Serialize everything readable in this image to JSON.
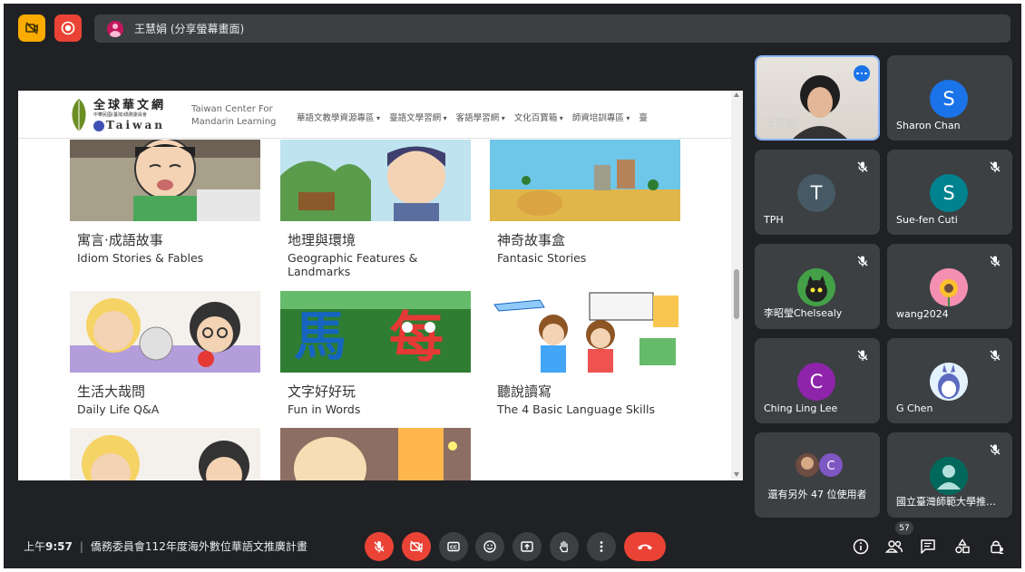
{
  "presenter": {
    "label": "王慧娟 (分享螢幕畫面)"
  },
  "site": {
    "logo_title": "全球華文網",
    "logo_sub": "中華民國(臺灣)僑務委員會",
    "logo_taiwan": "Taiwan",
    "center_name": "Taiwan Center For Mandarin Learning",
    "nav": [
      "華語文教學資源專區",
      "臺語文學習網",
      "客語學習網",
      "文化百寶箱",
      "師資培訓專區",
      "臺"
    ]
  },
  "cards": [
    {
      "zh": "寓言·成語故事",
      "en": "Idiom Stories & Fables"
    },
    {
      "zh": "地理與環境",
      "en": "Geographic Features & Landmarks"
    },
    {
      "zh": "神奇故事盒",
      "en": "Fantasic Stories"
    },
    {
      "zh": "生活大哉問",
      "en": "Daily Life Q&A"
    },
    {
      "zh": "文字好好玩",
      "en": "Fun in Words"
    },
    {
      "zh": "聽說讀寫",
      "en": "The 4 Basic Language Skills"
    }
  ],
  "participants": {
    "self_name": "王慧娟",
    "sharon": {
      "initial": "S",
      "name": "Sharon Chan",
      "color": "#1a73e8"
    },
    "tph": {
      "initial": "T",
      "name": "TPH",
      "color": "#455a64"
    },
    "suefen": {
      "initial": "S",
      "name": "Sue-fen Cuti",
      "color": "#00838f"
    },
    "chelsealy": {
      "name": "李昭瑩Chelsealy"
    },
    "wang2024": {
      "name": "wang2024"
    },
    "ching": {
      "initial": "C",
      "name": "Ching Ling Lee",
      "color": "#8e24aa"
    },
    "gchen": {
      "name": "G Chen"
    },
    "others": {
      "initial": "C",
      "label": "還有另外 47 位使用者"
    },
    "ntnu": {
      "name": "國立臺灣師範大學推…"
    }
  },
  "bottom": {
    "time_prefix": "上午",
    "time": "9:57",
    "meeting_title": "僑務委員會112年度海外數位華語文推廣計畫",
    "people_count": "57"
  },
  "colors": {
    "background": "#202124",
    "tile": "#3c4043",
    "danger": "#ea4335",
    "accent": "#1a73e8",
    "warning": "#f9ab00"
  }
}
